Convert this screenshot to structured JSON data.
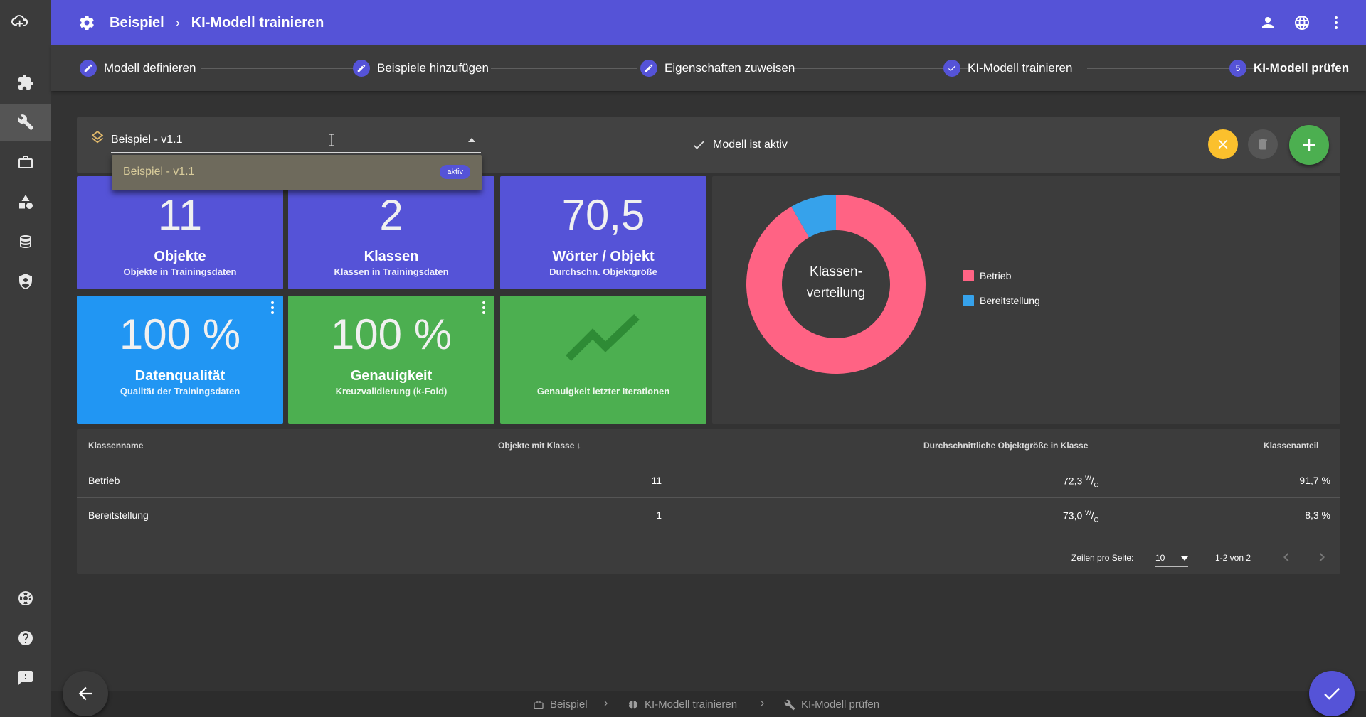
{
  "app": {
    "breadcrumb": [
      "Beispiel",
      "KI-Modell trainieren"
    ],
    "breadcrumb_separator": "›"
  },
  "nav": {
    "items": [
      "cloud-add-icon",
      "puzzle-icon",
      "wrench-icon",
      "briefcase-icon",
      "shapes-icon",
      "database-icon",
      "shield-icon",
      "lifebuoy-icon",
      "help-icon",
      "feedback-icon"
    ],
    "active": "wrench-icon"
  },
  "stepper": {
    "steps": [
      {
        "label": "Modell definieren",
        "state": "edit"
      },
      {
        "label": "Beispiele hinzufügen",
        "state": "edit"
      },
      {
        "label": "Eigenschaften zuweisen",
        "state": "edit"
      },
      {
        "label": "KI-Modell trainieren",
        "state": "done"
      },
      {
        "label": "KI-Modell prüfen",
        "state": "current",
        "number": "5"
      }
    ]
  },
  "model": {
    "selected": "Beispiel - v1.1",
    "status": "Modell ist aktiv",
    "dropdown": [
      {
        "label": "Beispiel - v1.1",
        "badge": "aktiv"
      }
    ]
  },
  "tiles": [
    {
      "value": "11",
      "title": "Objekte",
      "sub": "Objekte in Trainingsdaten",
      "color": "#5553d7"
    },
    {
      "value": "2",
      "title": "Klassen",
      "sub": "Klassen in Trainingsdaten",
      "color": "#5553d7"
    },
    {
      "value": "70,5",
      "title": "Wörter / Objekt",
      "sub": "Durchschn. Objektgröße",
      "color": "#5553d7"
    },
    {
      "value": "100 %",
      "title": "Datenqualität",
      "sub": "Qualität der Trainingsdaten",
      "color": "#2196f3"
    },
    {
      "value": "100 %",
      "title": "Genauigkeit",
      "sub": "Kreuzvalidierung (k-Fold)",
      "color": "#4caf50"
    },
    {
      "value": "",
      "title": "",
      "sub": "Genauigkeit letzter Iterationen",
      "color": "#4caf50"
    }
  ],
  "chart_data": {
    "type": "pie",
    "title": "Klassen-\nverteilung",
    "title_lines": [
      "Klassen-",
      "verteilung"
    ],
    "series": [
      {
        "name": "Betrieb",
        "value": 91.7,
        "color": "#ff6384"
      },
      {
        "name": "Bereitstellung",
        "value": 8.3,
        "color": "#36a2eb"
      }
    ],
    "legend_position": "right"
  },
  "table": {
    "headers": [
      "Klassenname",
      "Objekte mit Klasse",
      "Durchschnittliche Objektgröße in Klasse",
      "Klassenanteil"
    ],
    "sort_indicator": "↓",
    "rows": [
      {
        "name": "Betrieb",
        "count": "11",
        "avg": "72,3",
        "unit": "W/O",
        "share": "91,7 %"
      },
      {
        "name": "Bereitstellung",
        "count": "1",
        "avg": "73,0",
        "unit": "W/O",
        "share": "8,3 %"
      }
    ],
    "rows_per_page_label": "Zeilen pro Seite:",
    "rows_per_page": "10",
    "range": "1-2 von 2"
  },
  "bottom_breadcrumb": [
    "Beispiel",
    "KI-Modell trainieren",
    "KI-Modell prüfen"
  ],
  "colors": {
    "primary": "#5553d7",
    "success": "#4caf50",
    "warning": "#fbc02d",
    "info": "#2196f3"
  }
}
